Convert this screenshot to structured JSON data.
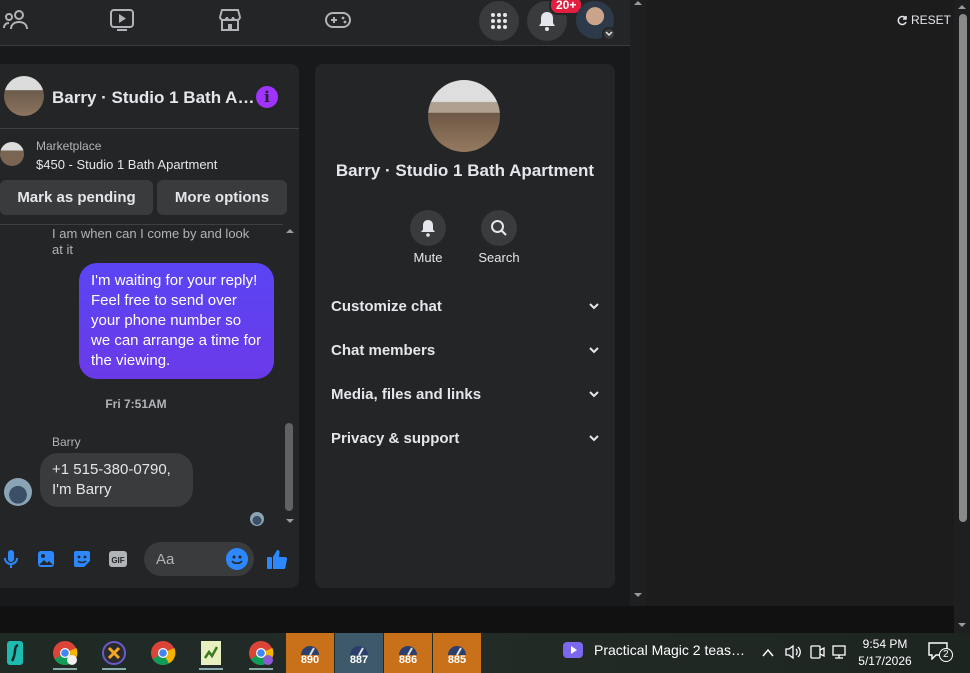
{
  "topbar": {
    "nav_icons": [
      "friends-icon",
      "watch-icon",
      "marketplace-icon",
      "gaming-icon"
    ],
    "menu_icon": "grid-menu-icon",
    "notifications_badge": "20+"
  },
  "chat": {
    "title": "Barry · Studio 1 Bath A…",
    "marketplace_label": "Marketplace",
    "marketplace_item": "$450 - Studio 1 Bath Apartment",
    "mark_pending": "Mark as pending",
    "more_options": "More options",
    "messages": {
      "prev_text": "I am when can I come by and look at it",
      "outgoing": "I'm waiting for your reply! Feel free to send over your phone number so we can arrange a time for the viewing.",
      "timestamp": "Fri 7:51AM",
      "sender": "Barry",
      "incoming": "+1 515-380-0790, I'm Barry"
    },
    "composer_placeholder": "Aa"
  },
  "side": {
    "title": "Barry · Studio 1 Bath Apartment",
    "mute": "Mute",
    "search": "Search",
    "sections": [
      "Customize chat",
      "Chat members",
      "Media, files and links",
      "Privacy & support"
    ]
  },
  "reset": "RESET",
  "taskbar": {
    "numbered": [
      "890",
      "887",
      "886",
      "885"
    ],
    "media_title": "Practical Magic 2 teas…",
    "time": "9:54 PM",
    "date": "5/17/2026",
    "notif_count": "2"
  },
  "colors": {
    "accent_purple": "#a033ff",
    "bubble": "#5b3ff0",
    "messenger_blue": "#2d88ff",
    "badge_red": "#e41e3f"
  }
}
